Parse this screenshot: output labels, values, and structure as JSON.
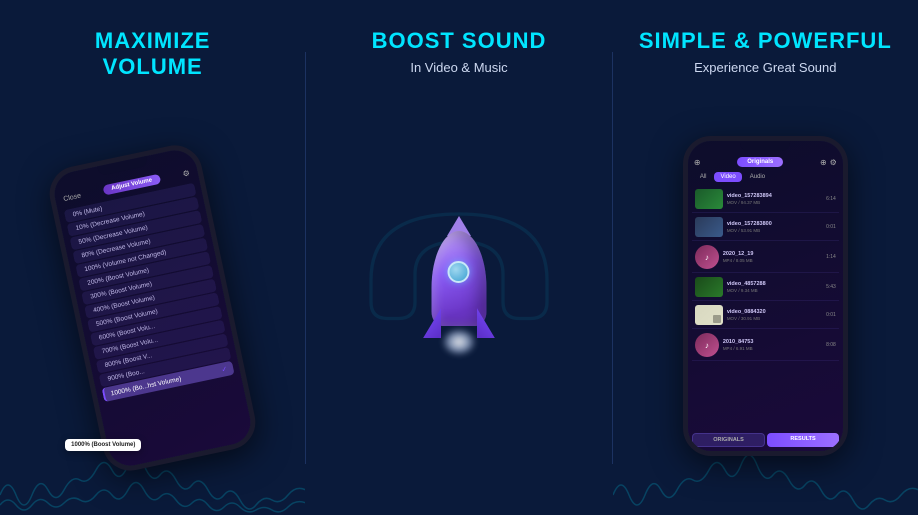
{
  "panels": [
    {
      "id": "panel1",
      "title": "MAXIMIZE\nVOLUME",
      "subtitle": "",
      "phone": {
        "topbar": {
          "close": "Close",
          "pill": "Adjust Volume",
          "icon": "⚙"
        },
        "volume_items": [
          {
            "label": "0% (Mute)",
            "selected": false
          },
          {
            "label": "10% (Decrease Volume)",
            "selected": false
          },
          {
            "label": "50% (Decrease Volume)",
            "selected": false
          },
          {
            "label": "80% (Decrease Volume)",
            "selected": false
          },
          {
            "label": "100% (Volume not Changed)",
            "selected": false
          },
          {
            "label": "200% (Boost Volume)",
            "selected": false
          },
          {
            "label": "300% (Boost Volume)",
            "selected": false
          },
          {
            "label": "400% (Boost Volume)",
            "selected": false
          },
          {
            "label": "500% (Boost Volume)",
            "selected": false
          },
          {
            "label": "600% (Boost Volu...",
            "selected": false
          },
          {
            "label": "700% (Boost Volu...",
            "selected": false
          },
          {
            "label": "800% (Boost V...",
            "selected": false
          },
          {
            "label": "900% (Boo...",
            "selected": false
          },
          {
            "label": "1000% (Bo... hst Volume)",
            "selected": true
          }
        ],
        "tooltip": "1000% (Boost Volume)"
      }
    },
    {
      "id": "panel2",
      "title": "BOOST SOUND",
      "subtitle": "In Video & Music"
    },
    {
      "id": "panel3",
      "title": "SIMPLE & POWERFUL",
      "subtitle": "Experience Great Sound",
      "phone": {
        "topbar": {
          "pill": "Originals",
          "icons": [
            "⊕",
            "⚙"
          ]
        },
        "tabs": [
          "All",
          "Video",
          "Audio"
        ],
        "active_tab": "Video",
        "media_items": [
          {
            "name": "video_157283894",
            "meta": "MOV / 94.37 MB",
            "duration": "6:14",
            "type": "video1"
          },
          {
            "name": "video_157283800",
            "meta": "MOV / 53.91 MB",
            "duration": "0:01",
            "type": "video2"
          },
          {
            "name": "2020_12_19",
            "meta": "MP4 / 8.05 MB",
            "duration": "1:14",
            "type": "audio1"
          },
          {
            "name": "video_4857288",
            "meta": "MOV / 9.34 MB",
            "duration": "5:43",
            "type": "video3"
          },
          {
            "name": "video_0884320",
            "meta": "MOV / 30.91 MB",
            "duration": "0:01",
            "type": "video4"
          },
          {
            "name": "2010_84753",
            "meta": "MP4 / 6.91 MB",
            "duration": "8:08",
            "type": "audio2"
          }
        ],
        "bottom_buttons": [
          "ORIGINALS",
          "RESULTS"
        ]
      }
    }
  ],
  "colors": {
    "accent_cyan": "#00e5ff",
    "accent_purple": "#7c4dff",
    "bg_dark": "#0a1a3a",
    "text_light": "#cdd8f0"
  }
}
